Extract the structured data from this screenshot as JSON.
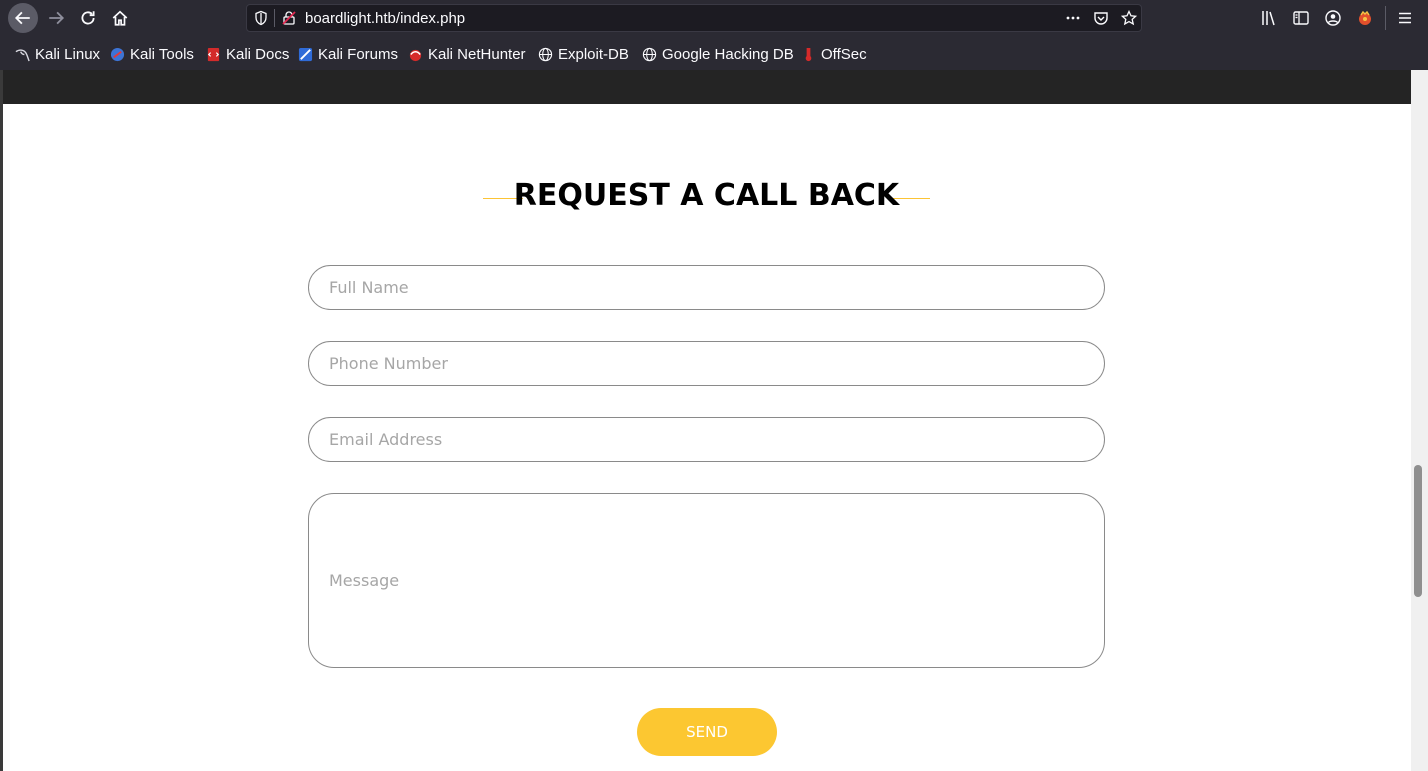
{
  "browser": {
    "url": "boardlight.htb/index.php",
    "bookmarks": [
      {
        "label": "Kali Linux",
        "icon": "kali-dragon-icon"
      },
      {
        "label": "Kali Tools",
        "icon": "kali-tools-icon"
      },
      {
        "label": "Kali Docs",
        "icon": "kali-docs-icon"
      },
      {
        "label": "Kali Forums",
        "icon": "kali-forums-icon"
      },
      {
        "label": "Kali NetHunter",
        "icon": "kali-nethunter-icon"
      },
      {
        "label": "Exploit-DB",
        "icon": "globe-icon"
      },
      {
        "label": "Google Hacking DB",
        "icon": "globe-icon"
      },
      {
        "label": "OffSec",
        "icon": "offsec-icon"
      }
    ]
  },
  "form": {
    "heading": "REQUEST A CALL BACK",
    "full_name_placeholder": "Full Name",
    "phone_placeholder": "Phone Number",
    "email_placeholder": "Email Address",
    "message_placeholder": "Message",
    "send_label": "SEND"
  },
  "colors": {
    "accent": "#fcc435",
    "chrome": "#2b2a33"
  }
}
